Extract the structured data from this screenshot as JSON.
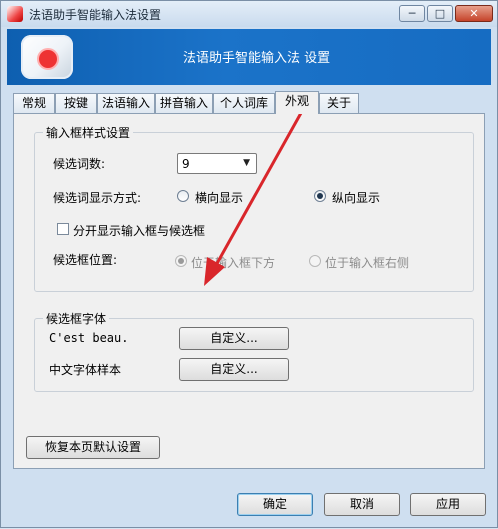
{
  "window": {
    "title": "法语助手智能输入法设置",
    "controls": {
      "minimize": "─",
      "maximize": "□",
      "close": "✕"
    }
  },
  "banner": {
    "title": "法语助手智能输入法 设置"
  },
  "tabs": [
    {
      "label": "常规"
    },
    {
      "label": "按键"
    },
    {
      "label": "法语输入"
    },
    {
      "label": "拼音输入"
    },
    {
      "label": "个人词库"
    },
    {
      "label": "外观"
    },
    {
      "label": "关于"
    }
  ],
  "active_tab": "外观",
  "style_group": {
    "title": "输入框样式设置",
    "candidate_count_label": "候选词数:",
    "candidate_count_value": "9",
    "display_mode_label": "候选词显示方式:",
    "display_horizontal": "横向显示",
    "display_vertical": "纵向显示",
    "display_selected": "vertical",
    "split_checkbox_label": "分开显示输入框与候选框",
    "split_checked": false,
    "position_label": "候选框位置:",
    "position_below": "位于输入框下方",
    "position_right": "位于输入框右侧",
    "position_selected": "below"
  },
  "font_group": {
    "title": "候选框字体",
    "latin_sample": "C'est beau.",
    "latin_button": "自定义...",
    "chinese_sample": "中文字体样本",
    "chinese_button": "自定义..."
  },
  "restore_button": "恢复本页默认设置",
  "footer": {
    "ok": "确定",
    "cancel": "取消",
    "apply": "应用"
  },
  "colors": {
    "banner": "#1b73c9",
    "annotation_arrow": "#d9262b"
  }
}
